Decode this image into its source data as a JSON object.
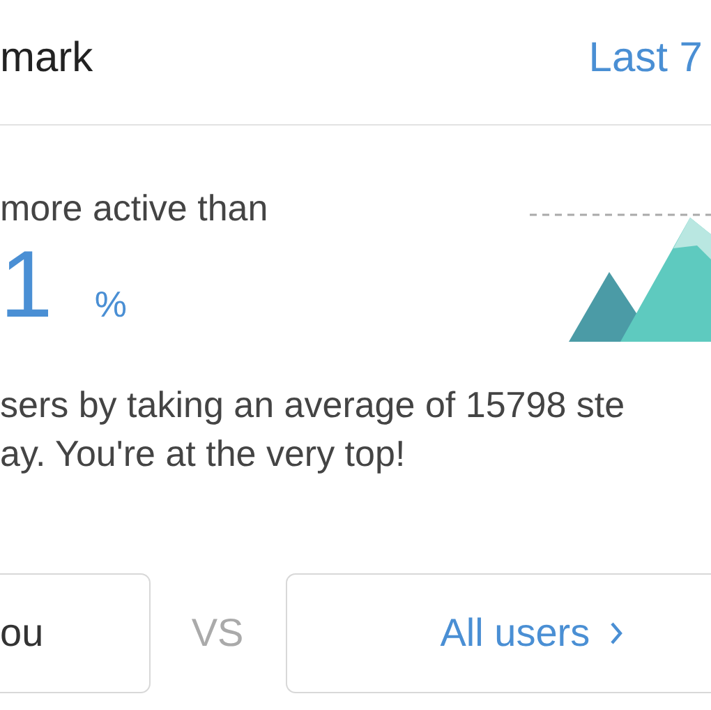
{
  "header": {
    "title": "mark",
    "period": "Last 7"
  },
  "stat": {
    "caption": "more active than",
    "value": "1",
    "unit": "%"
  },
  "description": [
    "sers by taking an average of 15798 ste",
    "ay. You're at the very top!"
  ],
  "compare": {
    "left": "ou",
    "separator": "VS",
    "right": "All users"
  }
}
